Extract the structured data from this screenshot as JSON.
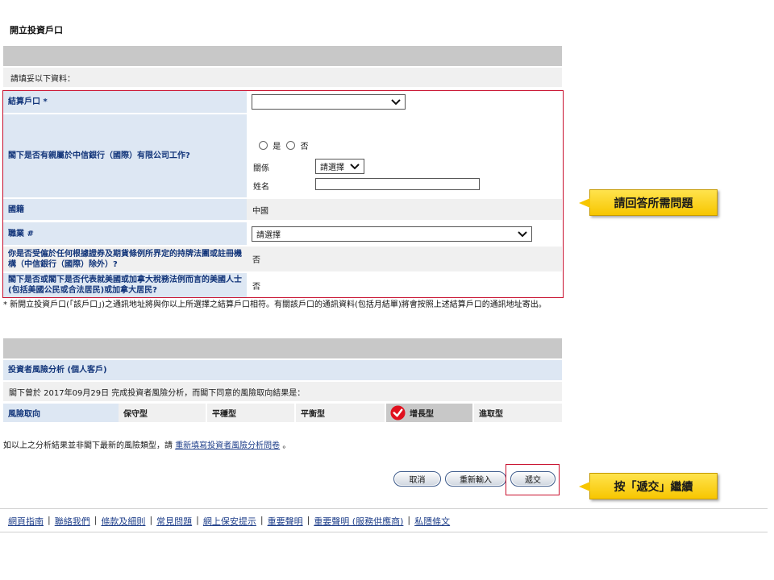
{
  "page": {
    "title": "開立投資戶口",
    "instruction": "請填妥以下資料："
  },
  "form": {
    "settlement_account": {
      "label": "結算戶口 *",
      "value": ""
    },
    "relative_question": {
      "label": "閣下是否有親屬於中信銀行（國際）有限公司工作?",
      "option_yes": "是",
      "option_no": "否",
      "relation_label": "關係",
      "relation_value": "請選擇",
      "name_label": "姓名",
      "name_value": ""
    },
    "nationality": {
      "label": "國籍",
      "value": "中國"
    },
    "occupation": {
      "label": "職業 #",
      "value": "請選擇"
    },
    "employed_question": {
      "label": "你是否受僱於任何根據證券及期貨條例所界定的持牌法團或註冊機構（中信銀行（國際）除外）?",
      "value": "否"
    },
    "us_canada_question": {
      "label": "閣下是否或閣下是否代表就美國或加拿大稅務法例而言的美國人士(包括美國公民或合法居民)或加拿大居民?",
      "value": "否"
    },
    "note": "* 新開立投資戶口(「該戶口」)之通訊地址將與你以上所選擇之結算戶口相符。有關該戶口的通訊資料(包括月結單)將會按照上述結算戶口的通訊地址寄出。"
  },
  "risk": {
    "section_title": "投資者風險分析 (個人客戶)",
    "completion_text": "閣下曾於 2017年09月29日 完成投資者風險分析，而閣下同意的風險取向結果是：",
    "header_label": "風險取向",
    "levels": [
      "保守型",
      "平穩型",
      "平衡型",
      "增長型",
      "進取型"
    ],
    "selected_level": "增長型",
    "retake_prefix": "如以上之分析結果並非閣下最新的風險類型，請",
    "retake_link": "重新填寫投資者風險分析問卷",
    "retake_suffix": "。"
  },
  "buttons": {
    "cancel": "取消",
    "reset": "重新輸入",
    "submit": "遞交"
  },
  "callouts": {
    "answer": "請回答所需問題",
    "submit": "按「遞交」繼續"
  },
  "footer": {
    "links": [
      "網頁指南",
      "聯絡我們",
      "條款及細則",
      "常見問題",
      "網上保安提示",
      "重要聲明",
      "重要聲明 (服務供應商)",
      "私隱條文"
    ]
  },
  "colors": {
    "label_blue": "#dde7f3",
    "label_text": "#12357a",
    "callout_yellow": "#f7c600",
    "highlight_red": "#c8102e",
    "check_red": "#e0101e"
  }
}
